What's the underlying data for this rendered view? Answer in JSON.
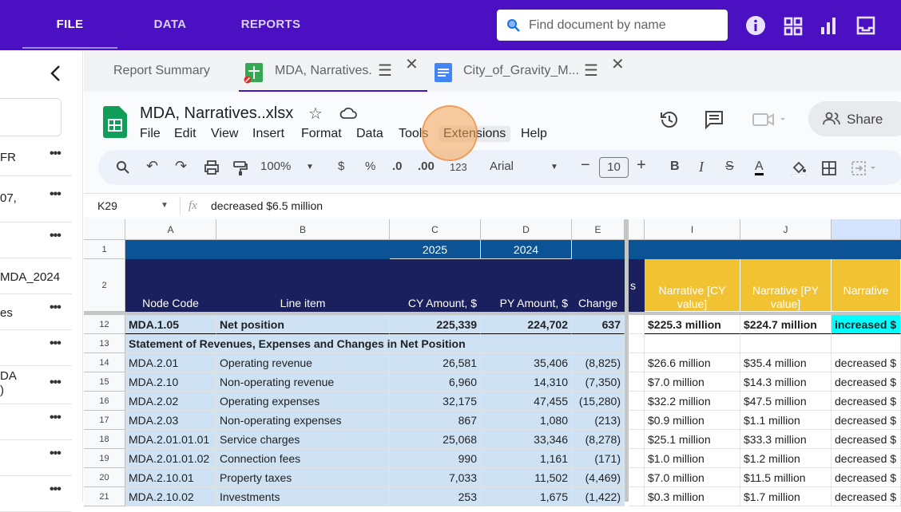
{
  "topnav": {
    "file": "FILE",
    "data": "DATA",
    "reports": "REPORTS"
  },
  "search": {
    "placeholder": "Find document by name"
  },
  "colors": {
    "brand": "#4a10c2",
    "header_dark": "#1a2a6c",
    "header_blue": "#0b5394",
    "narrative_yellow": "#f1c232",
    "selection": "#cfe2f3",
    "cyan": "#00ffff"
  },
  "left_panel": {
    "items": [
      "FR",
      "07,",
      "",
      "MDA_2024",
      "es",
      "",
      "DA",
      "",
      "",
      ""
    ],
    "item2_line2": ")"
  },
  "tabs": [
    {
      "label": "Report Summary"
    },
    {
      "label": "MDA, Narratives."
    },
    {
      "label": "City_of_Gravity_M..."
    }
  ],
  "doc": {
    "title": "MDA, Narratives..xlsx",
    "menus": [
      "File",
      "Edit",
      "View",
      "Insert",
      "Format",
      "Data",
      "Tools",
      "Extensions",
      "Help"
    ],
    "share": "Share"
  },
  "toolbar": {
    "zoom": "100%",
    "currency": "$",
    "percent": "%",
    "dec_dec": ".0",
    "inc_dec": ".00",
    "format123": "123",
    "font": "Arial",
    "font_size": "10"
  },
  "formula_bar": {
    "cell_ref": "K29",
    "fx": "fx",
    "value": "decreased $6.5 million"
  },
  "grid": {
    "columns": [
      "A",
      "B",
      "C",
      "D",
      "E",
      "I",
      "J"
    ],
    "row1": {
      "c": "2025",
      "d": "2024"
    },
    "row2": {
      "a": "Node Code",
      "b": "Line item",
      "c": "CY Amount, $",
      "d": "PY Amount, $",
      "e": "Change",
      "h_partial": "s",
      "i": "Narrative [CY value]",
      "j": "Narrative [PY value]",
      "k": "Narrative"
    },
    "row_numbers": [
      "1",
      "2",
      "12",
      "13",
      "14",
      "15",
      "16",
      "17",
      "18",
      "19",
      "20",
      "21"
    ],
    "rows": [
      {
        "n": "12",
        "a": "MDA.1.05",
        "b": "Net position",
        "c": "225,339",
        "d": "224,702",
        "e": "637",
        "i": "$225.3 million",
        "j": "$224.7 million",
        "k": "increased $",
        "bold": true
      },
      {
        "n": "13",
        "a": "Statement of Revenues, Expenses and Changes in Net Position",
        "b": "",
        "c": "",
        "d": "",
        "e": "",
        "i": "",
        "j": "",
        "k": "",
        "section": true
      },
      {
        "n": "14",
        "a": "MDA.2.01",
        "b": "Operating revenue",
        "c": "26,581",
        "d": "35,406",
        "e": "(8,825)",
        "i": "$26.6 million",
        "j": "$35.4 million",
        "k": "decreased $"
      },
      {
        "n": "15",
        "a": "MDA.2.10",
        "b": " Non-operating revenue",
        "c": "6,960",
        "d": "14,310",
        "e": "(7,350)",
        "i": "$7.0 million",
        "j": "$14.3 million",
        "k": "decreased $"
      },
      {
        "n": "16",
        "a": "MDA.2.02",
        "b": "Operating expenses",
        "c": "32,175",
        "d": "47,455",
        "e": "(15,280)",
        "i": "$32.2 million",
        "j": "$47.5 million",
        "k": "decreased $"
      },
      {
        "n": "17",
        "a": "MDA.2.03",
        "b": "Non-operating expenses",
        "c": "867",
        "d": "1,080",
        "e": "(213)",
        "i": "$0.9 million",
        "j": "$1.1 million",
        "k": "decreased $"
      },
      {
        "n": "18",
        "a": "MDA.2.01.01.01",
        "b": "Service charges",
        "c": "25,068",
        "d": "33,346",
        "e": "(8,278)",
        "i": "$25.1 million",
        "j": "$33.3 million",
        "k": "decreased $"
      },
      {
        "n": "19",
        "a": "MDA.2.01.01.02",
        "b": "Connection fees",
        "c": "990",
        "d": "1,161",
        "e": "(171)",
        "i": "$1.0 million",
        "j": "$1.2 million",
        "k": "decreased $"
      },
      {
        "n": "20",
        "a": "MDA.2.10.01",
        "b": "Property taxes",
        "c": "7,033",
        "d": "11,502",
        "e": "(4,469)",
        "i": "$7.0 million",
        "j": "$11.5 million",
        "k": "decreased $"
      },
      {
        "n": "21",
        "a": "MDA.2.10.02",
        "b": "Investments",
        "c": "253",
        "d": "1,675",
        "e": "(1,422)",
        "i": "$0.3 million",
        "j": "$1.7 million",
        "k": "decreased $"
      }
    ]
  }
}
